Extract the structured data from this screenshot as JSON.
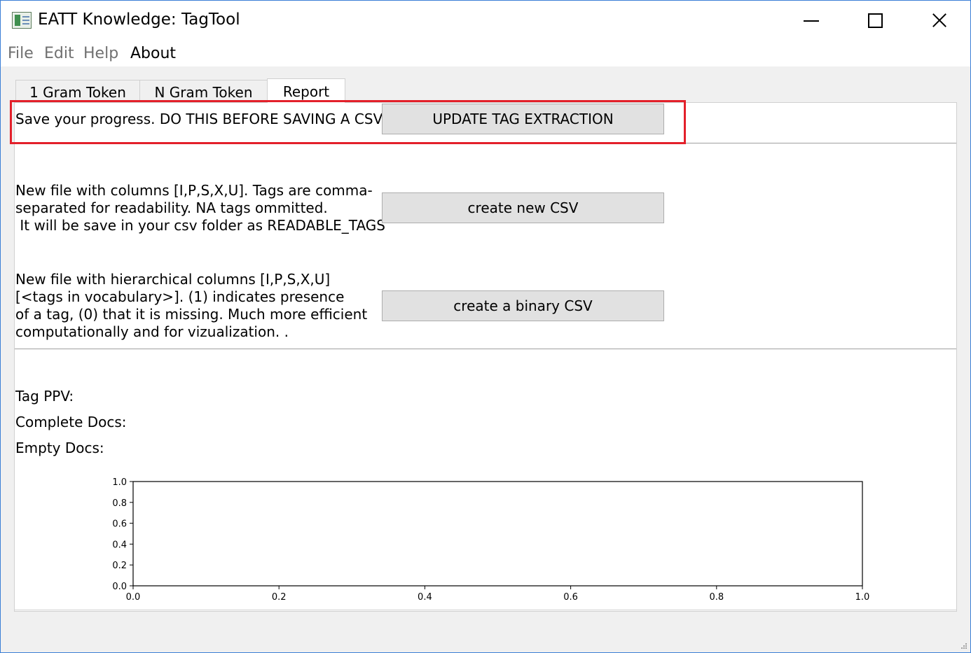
{
  "window": {
    "title": "EATT Knowledge:  TagTool",
    "minimize_icon": "minimize-icon",
    "maximize_icon": "maximize-icon",
    "close_icon": "close-icon"
  },
  "menu": {
    "file": "File",
    "edit": "Edit",
    "help": "Help",
    "about": "About"
  },
  "tabs": [
    {
      "label": "1 Gram Token"
    },
    {
      "label": "N Gram Token"
    },
    {
      "label": "Report"
    }
  ],
  "report": {
    "save_label": "Save your progress. DO THIS BEFORE SAVING A CSV!",
    "update_button": "UPDATE TAG EXTRACTION",
    "readable_desc": "New file with columns [I,P,S,X,U]. Tags are comma-\nseparated for readability. NA tags ommitted.\n It will be save in your csv folder as READABLE_TAGS",
    "create_csv_button": "create new CSV",
    "binary_desc": "New file with hierarchical columns [I,P,S,X,U]\n[<tags in vocabulary>]. (1) indicates presence\nof a tag, (0) that it is missing. Much more efficient\ncomputationally and for vizualization. .",
    "create_binary_button": "create a binary CSV",
    "tag_ppv_label": "Tag PPV:",
    "complete_docs_label": "Complete Docs:",
    "empty_docs_label": "Empty Docs:"
  },
  "colors": {
    "highlight": "#e3202a",
    "button_bg": "#e1e1e1"
  },
  "chart_data": {
    "type": "line",
    "title": "",
    "xlabel": "",
    "ylabel": "",
    "xlim": [
      0.0,
      1.0
    ],
    "ylim": [
      0.0,
      1.0
    ],
    "x_ticks": [
      "0.0",
      "0.2",
      "0.4",
      "0.6",
      "0.8",
      "1.0"
    ],
    "y_ticks": [
      "0.0",
      "0.2",
      "0.4",
      "0.6",
      "0.8",
      "1.0"
    ],
    "series": [],
    "grid": false
  }
}
